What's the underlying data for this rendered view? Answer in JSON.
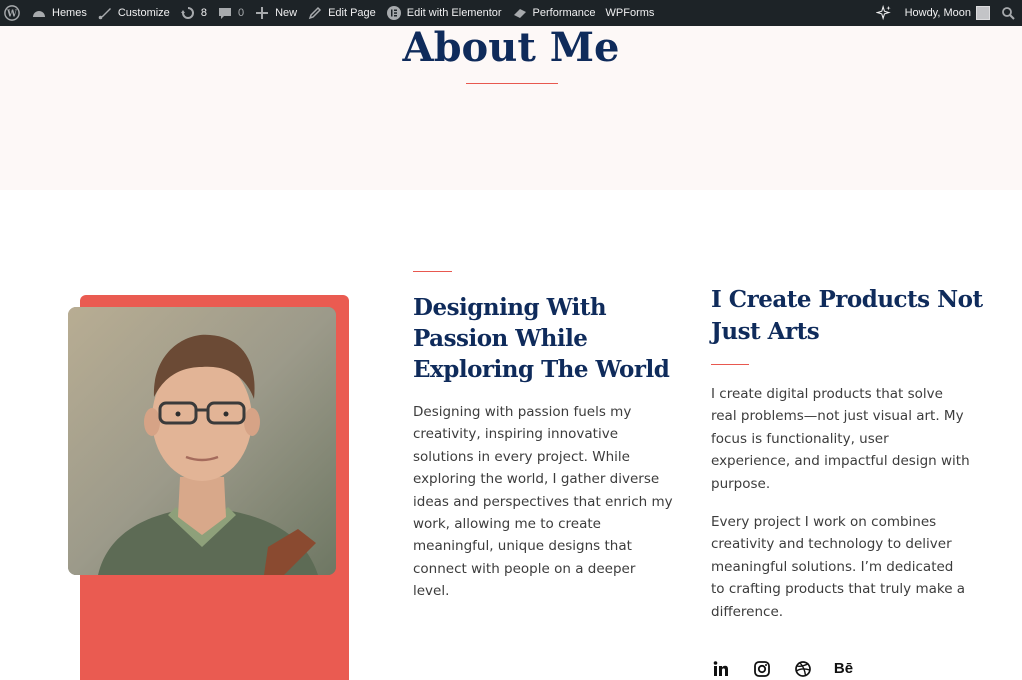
{
  "admin_bar": {
    "site_name": "Hemes",
    "customize": "Customize",
    "updates_count": "8",
    "comments_count": "0",
    "new_label": "New",
    "edit_page": "Edit Page",
    "edit_elementor": "Edit with Elementor",
    "performance": "Performance",
    "wpforms": "WPForms",
    "greeting": "Howdy, Moon"
  },
  "hero": {
    "title": "About Me"
  },
  "about": {
    "mid_heading": "Designing With Passion While Exploring The World",
    "mid_paragraph": "Designing with passion fuels my creativity, inspiring innovative solutions in every project. While exploring the world, I gather diverse ideas and perspectives that enrich my work, allowing me to create meaningful, unique designs that connect with people on a deeper level.",
    "right_heading": "I Create Products Not Just Arts",
    "right_paragraph_1": "I create digital products that solve real problems—not just visual art. My focus is functionality, user experience, and impactful design with purpose.",
    "right_paragraph_2": "Every project I work on combines creativity and technology to deliver meaningful solutions. I’m dedicated to crafting products that truly make a difference.",
    "socials": [
      {
        "name": "linkedin-icon",
        "glyph": "in"
      },
      {
        "name": "instagram-icon",
        "glyph": ""
      },
      {
        "name": "dribbble-icon",
        "glyph": ""
      },
      {
        "name": "behance-icon",
        "glyph": "Bē"
      }
    ]
  },
  "colors": {
    "accent": "#ea5b51",
    "heading": "#0f2b5b",
    "hero_bg": "#fdf8f7",
    "admin_bar": "#1d2327"
  }
}
